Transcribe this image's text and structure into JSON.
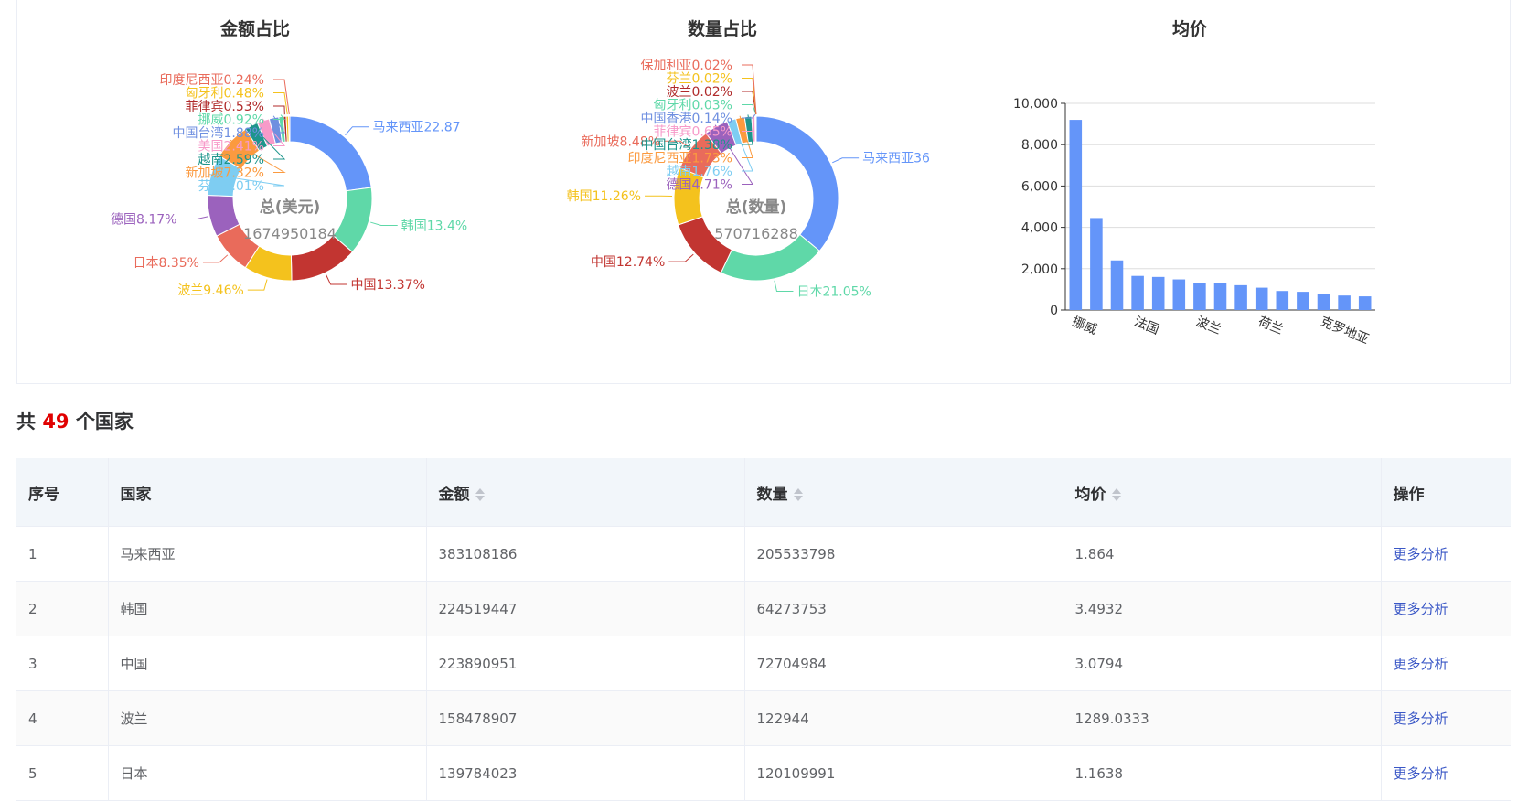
{
  "charts": {
    "amount_title": "金额占比",
    "quantity_title": "数量占比",
    "price_title": "均价"
  },
  "chart_data": [
    {
      "type": "pie",
      "title": "金额占比",
      "center_label": "总(美元)",
      "center_value": "1674950184",
      "slices": [
        {
          "label": "马来西亚",
          "text": "马来西亚22.87",
          "value": 22.87,
          "color": "#6495f9"
        },
        {
          "label": "韩国",
          "text": "韩国13.4%",
          "value": 13.4,
          "color": "#5fd8a8"
        },
        {
          "label": "中国",
          "text": "中国13.37%",
          "value": 13.37,
          "color": "#c23531"
        },
        {
          "label": "波兰",
          "text": "波兰9.46%",
          "value": 9.46,
          "color": "#f4c21d"
        },
        {
          "label": "日本",
          "text": "日本8.35%",
          "value": 8.35,
          "color": "#e96b5b"
        },
        {
          "label": "德国",
          "text": "德国8.17%",
          "value": 8.17,
          "color": "#9b62bd"
        },
        {
          "label": "芬兰",
          "text": "芬兰8.01%",
          "value": 8.01,
          "color": "#7ecdf2"
        },
        {
          "label": "新加坡",
          "text": "新加坡7.32%",
          "value": 7.32,
          "color": "#fb9a3f"
        },
        {
          "label": "越南",
          "text": "越南2.59%",
          "value": 2.59,
          "color": "#1e958c"
        },
        {
          "label": "美国",
          "text": "美国2.41%",
          "value": 2.41,
          "color": "#f79ac9"
        },
        {
          "label": "中国台湾",
          "text": "中国台湾1.88%",
          "value": 1.88,
          "color": "#6f8fe0"
        },
        {
          "label": "挪威",
          "text": "挪威0.92%",
          "value": 0.92,
          "color": "#5fd8a8"
        },
        {
          "label": "菲律宾",
          "text": "菲律宾0.53%",
          "value": 0.53,
          "color": "#b02a2a"
        },
        {
          "label": "匈牙利",
          "text": "匈牙利0.48%",
          "value": 0.48,
          "color": "#f4c21d"
        },
        {
          "label": "印度尼西亚",
          "text": "印度尼西亚0.24%",
          "value": 0.24,
          "color": "#e96b5b"
        }
      ]
    },
    {
      "type": "pie",
      "title": "数量占比",
      "center_label": "总(数量)",
      "center_value": "570716288",
      "slices": [
        {
          "label": "马来西亚",
          "text": "马来西亚36",
          "value": 36.01,
          "color": "#6495f9"
        },
        {
          "label": "日本",
          "text": "日本21.05%",
          "value": 21.05,
          "color": "#5fd8a8"
        },
        {
          "label": "中国",
          "text": "中国12.74%",
          "value": 12.74,
          "color": "#c23531"
        },
        {
          "label": "韩国",
          "text": "韩国11.26%",
          "value": 11.26,
          "color": "#f4c21d"
        },
        {
          "label": "新加坡",
          "text": "新加坡8.48%",
          "value": 8.48,
          "color": "#e96b5b"
        },
        {
          "label": "德国",
          "text": "德国4.71%",
          "value": 4.71,
          "color": "#9b62bd"
        },
        {
          "label": "越南",
          "text": "越南1.76%",
          "value": 1.76,
          "color": "#7ecdf2"
        },
        {
          "label": "印度尼西亚",
          "text": "印度尼西亚1.73%",
          "value": 1.73,
          "color": "#fb9a3f"
        },
        {
          "label": "中国台湾",
          "text": "中国台湾1.38%",
          "value": 1.38,
          "color": "#1e958c"
        },
        {
          "label": "菲律宾",
          "text": "菲律宾0.65%",
          "value": 0.65,
          "color": "#f79ac9"
        },
        {
          "label": "中国香港",
          "text": "中国香港0.14%",
          "value": 0.14,
          "color": "#6f8fe0"
        },
        {
          "label": "匈牙利",
          "text": "匈牙利0.03%",
          "value": 0.03,
          "color": "#5fd8a8"
        },
        {
          "label": "波兰",
          "text": "波兰0.02%",
          "value": 0.02,
          "color": "#b02a2a"
        },
        {
          "label": "芬兰",
          "text": "芬兰0.02%",
          "value": 0.02,
          "color": "#f4c21d"
        },
        {
          "label": "保加利亚",
          "text": "保加利亚0.02%",
          "value": 0.02,
          "color": "#e96b5b"
        }
      ]
    },
    {
      "type": "bar",
      "title": "均价",
      "ylim": [
        0,
        10000
      ],
      "yticks": [
        "0",
        "2,000",
        "4,000",
        "6,000",
        "8,000",
        "10,000"
      ],
      "yticks_values": [
        0,
        2000,
        4000,
        6000,
        8000,
        10000
      ],
      "categories": [
        "挪威",
        "",
        "",
        "法国",
        "",
        "",
        "波兰",
        "",
        "",
        "荷兰",
        "",
        "",
        "克罗地亚",
        "",
        ""
      ],
      "values": [
        9200,
        4450,
        2400,
        1650,
        1600,
        1480,
        1320,
        1290,
        1200,
        1080,
        920,
        880,
        770,
        700,
        660
      ],
      "color": "#6495f9"
    }
  ],
  "summary": {
    "prefix": "共",
    "count": "49",
    "suffix": "个国家"
  },
  "table": {
    "headers": [
      "序号",
      "国家",
      "金额",
      "数量",
      "均价",
      "操作"
    ],
    "rows": [
      {
        "idx": "1",
        "country": "马来西亚",
        "amount": "383108186",
        "qty": "205533798",
        "price": "1.864",
        "action": "更多分析"
      },
      {
        "idx": "2",
        "country": "韩国",
        "amount": "224519447",
        "qty": "64273753",
        "price": "3.4932",
        "action": "更多分析"
      },
      {
        "idx": "3",
        "country": "中国",
        "amount": "223890951",
        "qty": "72704984",
        "price": "3.0794",
        "action": "更多分析"
      },
      {
        "idx": "4",
        "country": "波兰",
        "amount": "158478907",
        "qty": "122944",
        "price": "1289.0333",
        "action": "更多分析"
      },
      {
        "idx": "5",
        "country": "日本",
        "amount": "139784023",
        "qty": "120109991",
        "price": "1.1638",
        "action": "更多分析"
      }
    ]
  }
}
